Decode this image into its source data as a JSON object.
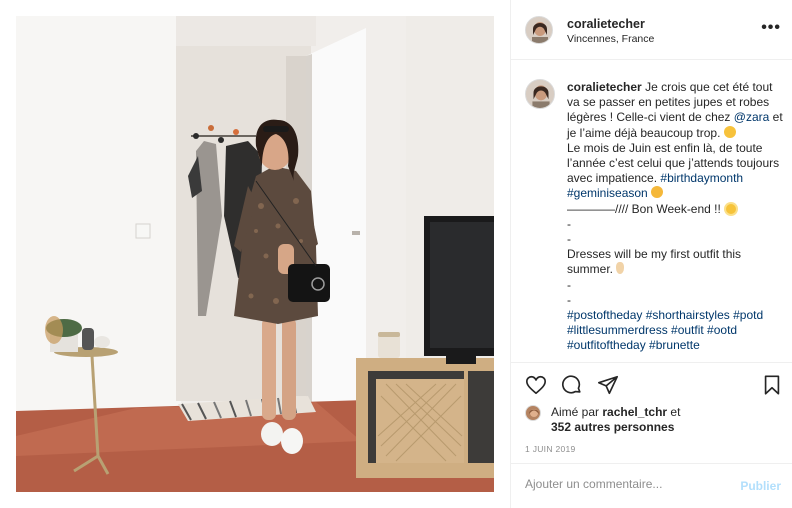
{
  "header": {
    "username": "coralietecher",
    "location": "Vincennes, France",
    "more_label": "•••"
  },
  "caption": {
    "username": "coralietecher",
    "line1": "Je crois que cet été tout va se passer en petites jupes et robes légères ! Celle-ci vient de chez",
    "mention": "@zara",
    "line1b": "et je l’aime déjà beaucoup trop.",
    "line2": "Le mois de Juin est enfin là, de toute l’année c’est celui que j’attends toujours avec impatience.",
    "hashtag1": "#birthdaymonth",
    "hashtag2": "#geminiseason",
    "line3": "————//// Bon Week-end !!",
    "dash1": "-",
    "dash2": "-",
    "line4": "Dresses will be my first outfit this summer.",
    "dash3": "-",
    "dash4": "-",
    "tags": "#postoftheday #shorthairstyles #potd #littlesummerdress #outfit #ootd #outfitoftheday #brunette"
  },
  "likes": {
    "prefix": "Aimé par",
    "user": "rachel_tchr",
    "and": "et",
    "others": "352 autres personnes"
  },
  "date": "1 JUIN 2019",
  "comment": {
    "placeholder": "Ajouter un commentaire...",
    "publish_label": "Publier"
  },
  "colors": {
    "link": "#00376b",
    "publish_disabled": "#b2dffc",
    "muted": "#8e8e8e",
    "text": "#262626"
  },
  "icons": [
    "heart-icon",
    "comment-icon",
    "share-icon",
    "bookmark-icon",
    "more-options-icon",
    "chevron-right-icon"
  ]
}
